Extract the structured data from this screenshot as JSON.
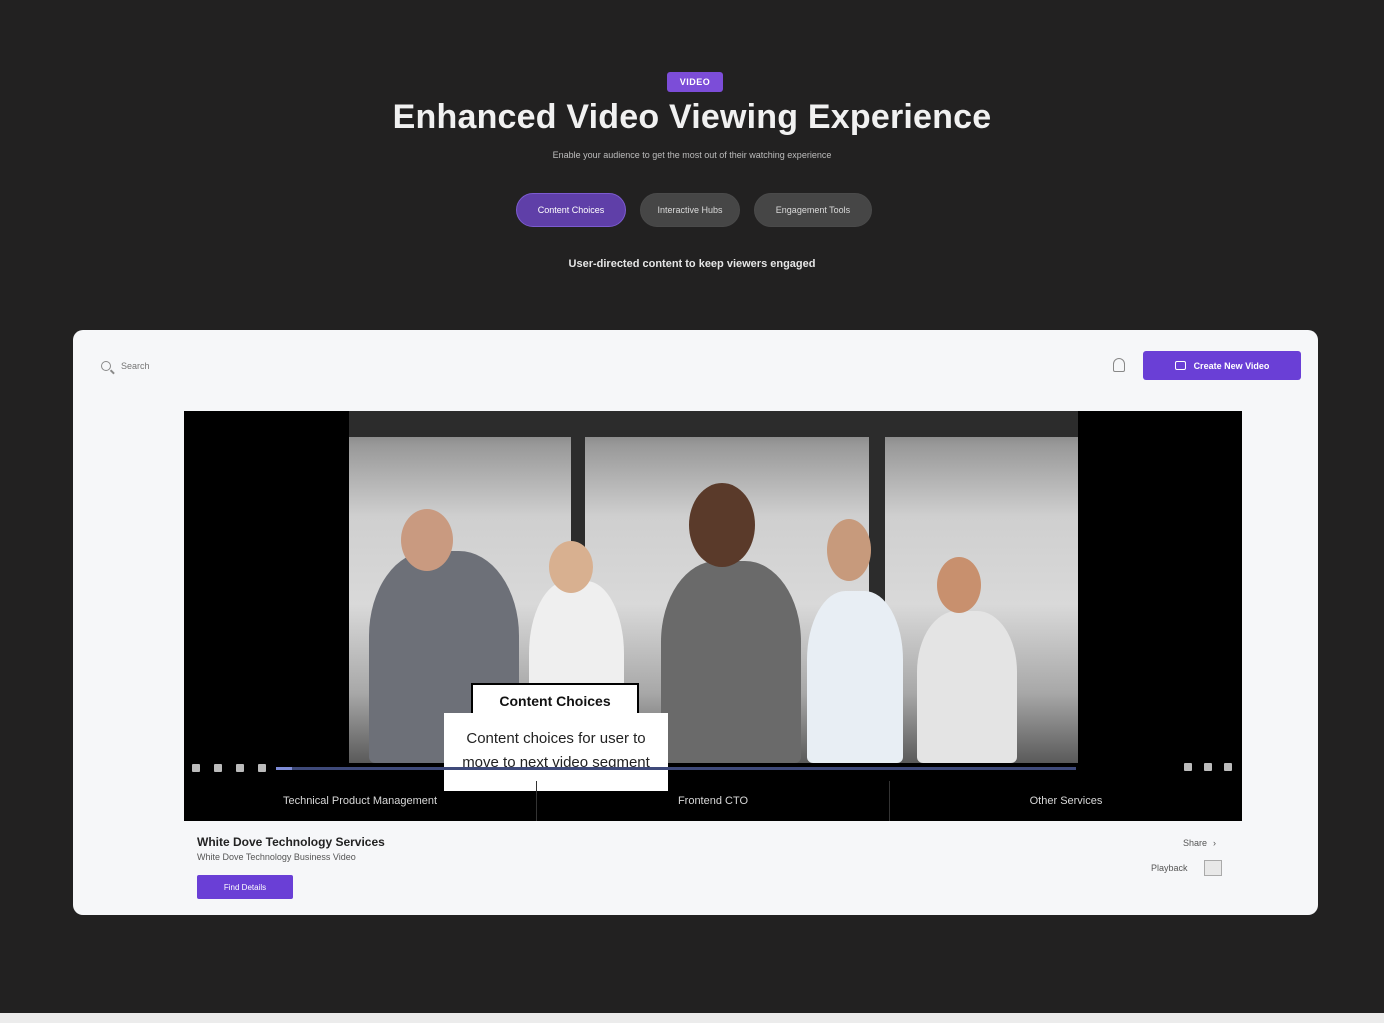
{
  "hero": {
    "badge": "VIDEO",
    "title": "Enhanced Video Viewing Experience",
    "subtitle": "Enable your audience to get the most out of their watching experience",
    "tabs": [
      {
        "label": "Content Choices",
        "active": true
      },
      {
        "label": "Interactive Hubs",
        "active": false
      },
      {
        "label": "Engagement Tools",
        "active": false
      }
    ],
    "caption": "User-directed content to keep viewers engaged"
  },
  "toolbar": {
    "search_placeholder": "Search",
    "create_label": "Create New Video"
  },
  "player": {
    "choice_title": "Content Choices",
    "choice_desc": "Content choices for user to move to next video segment",
    "progress": 0.02,
    "segments": [
      "Technical Product Management",
      "Frontend CTO",
      "Other Services"
    ]
  },
  "meta": {
    "title": "White Dove Technology Services",
    "subtitle": "White Dove Technology Business Video",
    "button_label": "Find Details",
    "share_label": "Share",
    "share_icon": "chevron-right-icon",
    "speed_label": "Playback"
  },
  "colors": {
    "accent": "#6a3fd6",
    "background": "#222121",
    "card": "#f6f7f9"
  }
}
